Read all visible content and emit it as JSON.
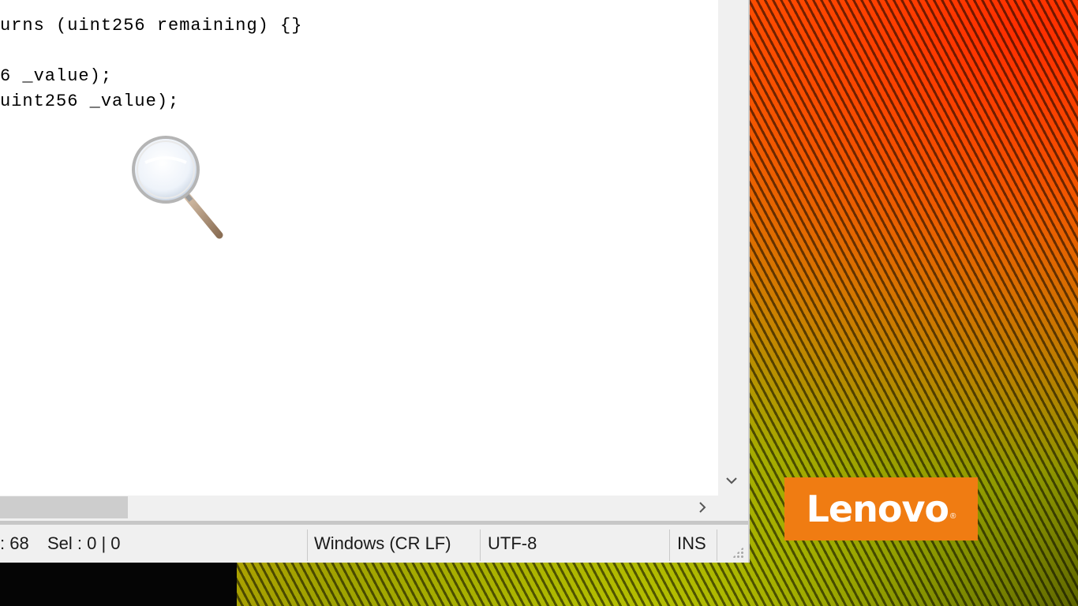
{
  "editor": {
    "lines": [
      "urns (uint256 remaining) {}",
      "",
      "6 _value);",
      "uint256 _value);"
    ]
  },
  "statusbar": {
    "position": ": 68",
    "selection": "Sel : 0 | 0",
    "line_ending": "Windows (CR LF)",
    "encoding": "UTF-8",
    "insert_mode": "INS"
  },
  "scroll": {
    "down_icon": "chevron-down-icon",
    "right_icon": "chevron-right-icon"
  },
  "desktop": {
    "logo_text": "Lenovo",
    "logo_mark": "®",
    "logo_color": "#f07c12"
  },
  "cursor": {
    "icon": "magnifier-icon"
  }
}
